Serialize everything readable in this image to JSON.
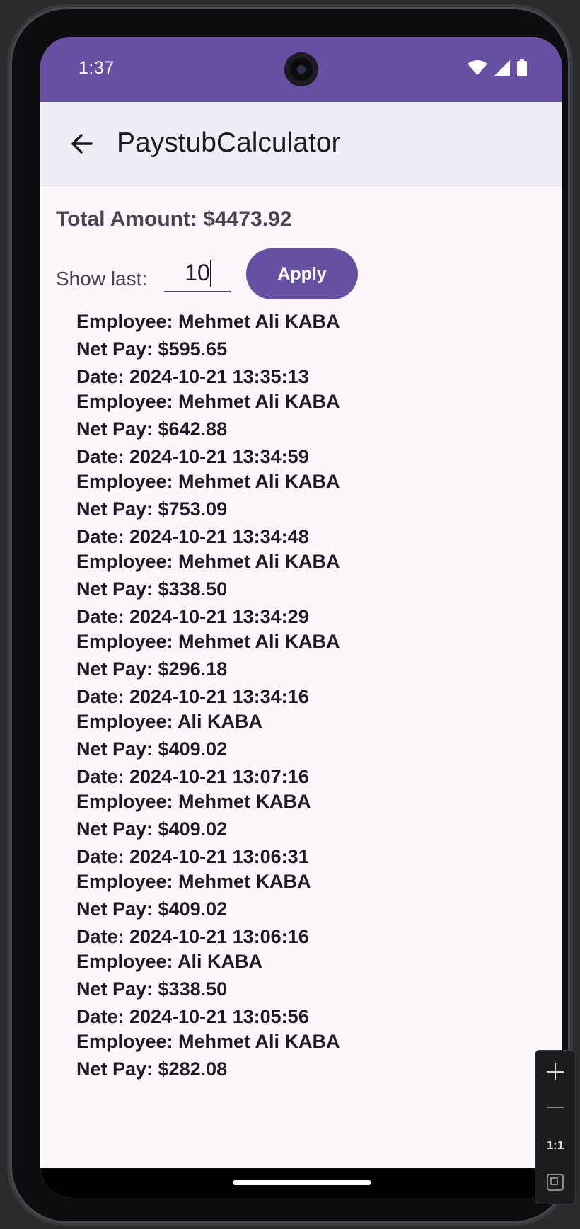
{
  "status_bar": {
    "time": "1:37"
  },
  "app_bar": {
    "title": "PaystubCalculator"
  },
  "summary": {
    "total": "Total Amount: $4473.92"
  },
  "filter": {
    "label": "Show last:",
    "value": "10",
    "apply_label": "Apply"
  },
  "entries": [
    {
      "employee": "Employee: Mehmet Ali KABA",
      "net_pay": "Net Pay: $595.65",
      "date": "Date: 2024-10-21 13:35:13"
    },
    {
      "employee": "Employee: Mehmet Ali KABA",
      "net_pay": "Net Pay: $642.88",
      "date": "Date: 2024-10-21 13:34:59"
    },
    {
      "employee": "Employee: Mehmet Ali KABA",
      "net_pay": "Net Pay: $753.09",
      "date": "Date: 2024-10-21 13:34:48"
    },
    {
      "employee": "Employee: Mehmet Ali KABA",
      "net_pay": "Net Pay: $338.50",
      "date": "Date: 2024-10-21 13:34:29"
    },
    {
      "employee": "Employee: Mehmet Ali KABA",
      "net_pay": "Net Pay: $296.18",
      "date": "Date: 2024-10-21 13:34:16"
    },
    {
      "employee": "Employee: Ali KABA",
      "net_pay": "Net Pay: $409.02",
      "date": "Date: 2024-10-21 13:07:16"
    },
    {
      "employee": "Employee: Mehmet KABA",
      "net_pay": "Net Pay: $409.02",
      "date": "Date: 2024-10-21 13:06:31"
    },
    {
      "employee": "Employee: Mehmet KABA",
      "net_pay": "Net Pay: $409.02",
      "date": "Date: 2024-10-21 13:06:16"
    },
    {
      "employee": "Employee: Ali KABA",
      "net_pay": "Net Pay: $338.50",
      "date": "Date: 2024-10-21 13:05:56"
    },
    {
      "employee": "Employee: Mehmet Ali KABA",
      "net_pay": "Net Pay: $282.08",
      "date": ""
    }
  ],
  "zoom_controls": {
    "one_to_one": "1:1"
  },
  "icons": {
    "back": "arrow-back-icon",
    "wifi": "wifi-icon",
    "signal": "cell-signal-icon",
    "battery": "battery-icon",
    "zoom_in": "plus-icon",
    "zoom_out": "minus-icon",
    "fit": "fit-screen-icon"
  },
  "colors": {
    "primary": "#6750a4",
    "app_bar": "#f1edf6",
    "background": "#fbf7fb"
  }
}
